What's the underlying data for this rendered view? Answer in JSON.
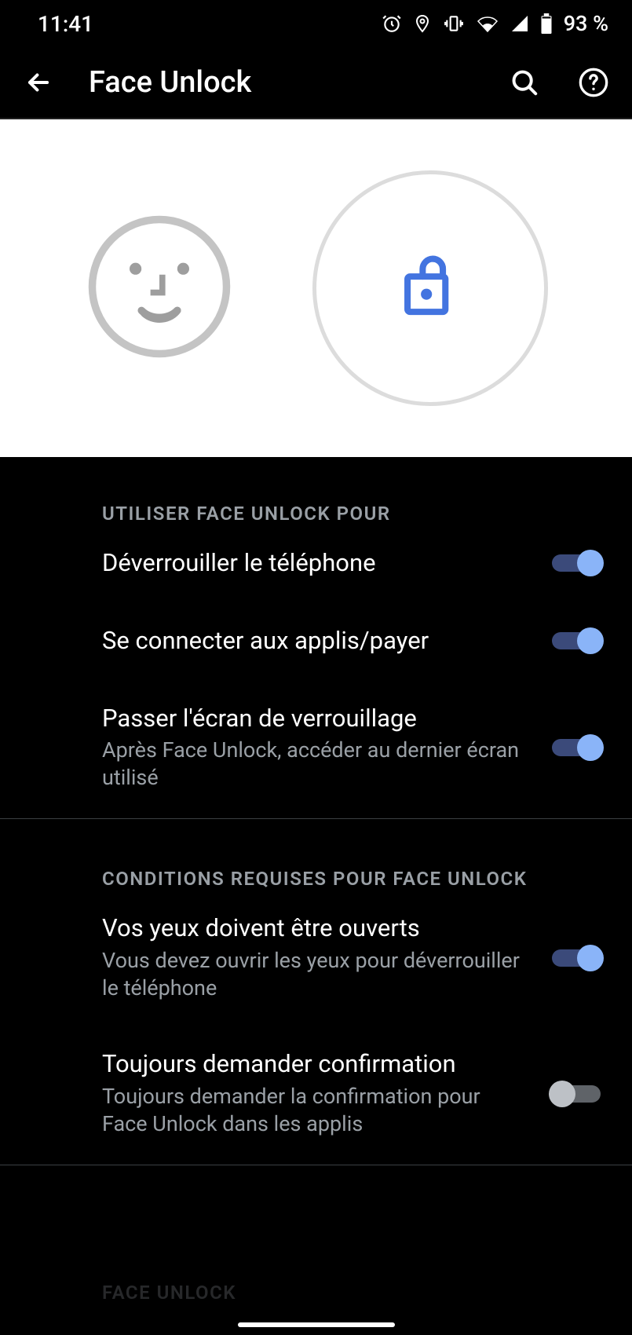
{
  "status": {
    "time": "11:41",
    "battery": "93 %"
  },
  "appbar": {
    "title": "Face Unlock"
  },
  "sections": {
    "use": {
      "header": "UTILISER FACE UNLOCK POUR",
      "items": [
        {
          "title": "Déverrouiller le téléphone",
          "sub": "",
          "on": true
        },
        {
          "title": "Se connecter aux applis/payer",
          "sub": "",
          "on": true
        },
        {
          "title": "Passer l'écran de verrouillage",
          "sub": "Après Face Unlock, accéder au dernier écran utilisé",
          "on": true
        }
      ]
    },
    "req": {
      "header": "CONDITIONS REQUISES POUR FACE UNLOCK",
      "items": [
        {
          "title": "Vos yeux doivent être ouverts",
          "sub": "Vous devez ouvrir les yeux pour déverrouiller le téléphone",
          "on": true
        },
        {
          "title": "Toujours demander confirmation",
          "sub": "Toujours demander la confirmation pour Face Unlock dans les applis",
          "on": false
        }
      ]
    },
    "cut": {
      "header": "FACE UNLOCK"
    }
  }
}
